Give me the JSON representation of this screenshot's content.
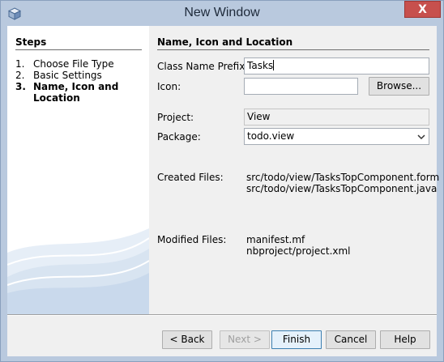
{
  "window": {
    "title": "New Window",
    "close_label": "X"
  },
  "steps": {
    "title": "Steps",
    "items": [
      {
        "num": "1.",
        "label": "Choose File Type"
      },
      {
        "num": "2.",
        "label": "Basic Settings"
      },
      {
        "num": "3.",
        "label": "Name, Icon and Location"
      }
    ]
  },
  "panel": {
    "title": "Name, Icon and Location",
    "prefix_label": "Class Name Prefix:",
    "prefix_value": "Tasks",
    "icon_label": "Icon:",
    "icon_value": "",
    "browse_label": "Browse...",
    "project_label": "Project:",
    "project_value": "View",
    "package_label": "Package:",
    "package_value": "todo.view",
    "created_label": "Created Files:",
    "created_files": [
      "src/todo/view/TasksTopComponent.form",
      "src/todo/view/TasksTopComponent.java"
    ],
    "modified_label": "Modified Files:",
    "modified_files": [
      "manifest.mf",
      "nbproject/project.xml"
    ]
  },
  "buttons": {
    "back": "< Back",
    "next": "Next >",
    "finish": "Finish",
    "cancel": "Cancel",
    "help": "Help"
  },
  "icons": {
    "app": "netbeans-cube-icon",
    "combo_arrow": "chevron-down-icon"
  }
}
